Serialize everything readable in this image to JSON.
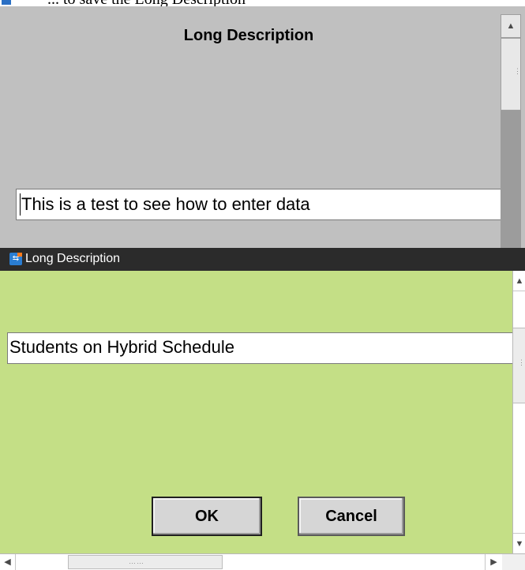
{
  "top_caption": {
    "text": "... to save the Long Description"
  },
  "upper_window": {
    "title": "Long Description",
    "field_value": "This is a test to see how to enter data"
  },
  "lower_window": {
    "titlebar_title": "Long Description",
    "field_value": "Students on Hybrid Schedule",
    "ok_label": "OK",
    "cancel_label": "Cancel"
  },
  "colors": {
    "upper_bg": "#c0c0c0",
    "lower_bg": "#c4df86",
    "titlebar_bg": "#2b2b2b"
  },
  "icons": [
    "app-icon",
    "scroll-up-arrow-icon",
    "scroll-down-arrow-icon",
    "scroll-left-arrow-icon",
    "scroll-right-arrow-icon"
  ]
}
